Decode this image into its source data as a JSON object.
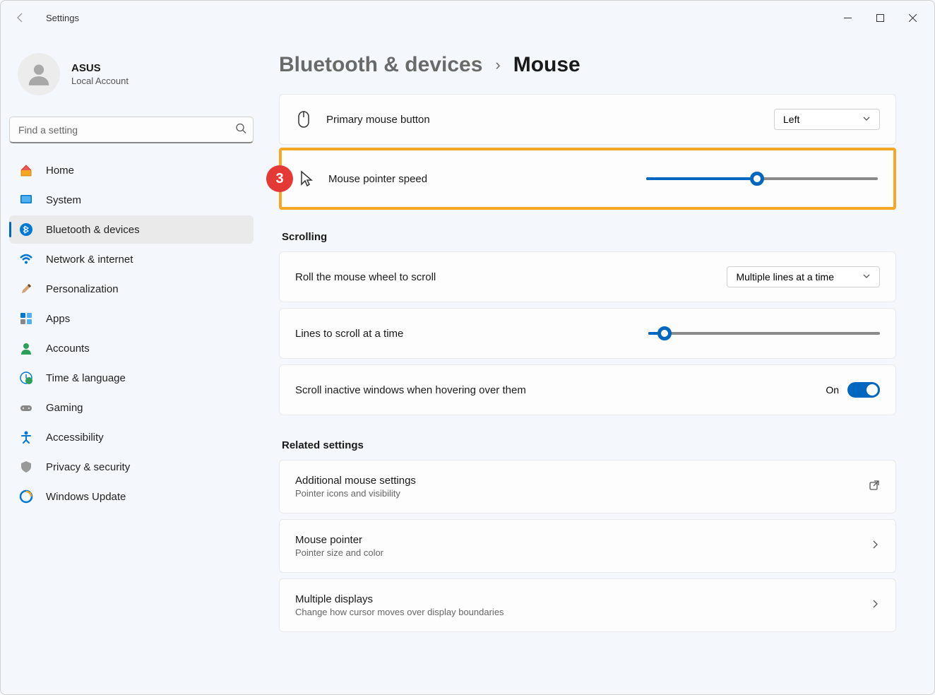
{
  "app_title": "Settings",
  "profile": {
    "name": "ASUS",
    "subtitle": "Local Account"
  },
  "search": {
    "placeholder": "Find a setting"
  },
  "sidebar": {
    "items": [
      {
        "label": "Home"
      },
      {
        "label": "System"
      },
      {
        "label": "Bluetooth & devices"
      },
      {
        "label": "Network & internet"
      },
      {
        "label": "Personalization"
      },
      {
        "label": "Apps"
      },
      {
        "label": "Accounts"
      },
      {
        "label": "Time & language"
      },
      {
        "label": "Gaming"
      },
      {
        "label": "Accessibility"
      },
      {
        "label": "Privacy & security"
      },
      {
        "label": "Windows Update"
      }
    ]
  },
  "breadcrumb": {
    "parent": "Bluetooth & devices",
    "current": "Mouse"
  },
  "settings": {
    "primary_button": {
      "label": "Primary mouse button",
      "value": "Left"
    },
    "pointer_speed": {
      "label": "Mouse pointer speed",
      "value_percent": 48
    },
    "scrolling_header": "Scrolling",
    "roll_wheel": {
      "label": "Roll the mouse wheel to scroll",
      "value": "Multiple lines at a time"
    },
    "lines_scroll": {
      "label": "Lines to scroll at a time",
      "value_percent": 7
    },
    "scroll_inactive": {
      "label": "Scroll inactive windows when hovering over them",
      "state_label": "On"
    },
    "related_header": "Related settings",
    "additional": {
      "title": "Additional mouse settings",
      "subtitle": "Pointer icons and visibility"
    },
    "mouse_pointer": {
      "title": "Mouse pointer",
      "subtitle": "Pointer size and color"
    },
    "multiple_displays": {
      "title": "Multiple displays",
      "subtitle": "Change how cursor moves over display boundaries"
    }
  },
  "annotation": {
    "badge": "3"
  }
}
